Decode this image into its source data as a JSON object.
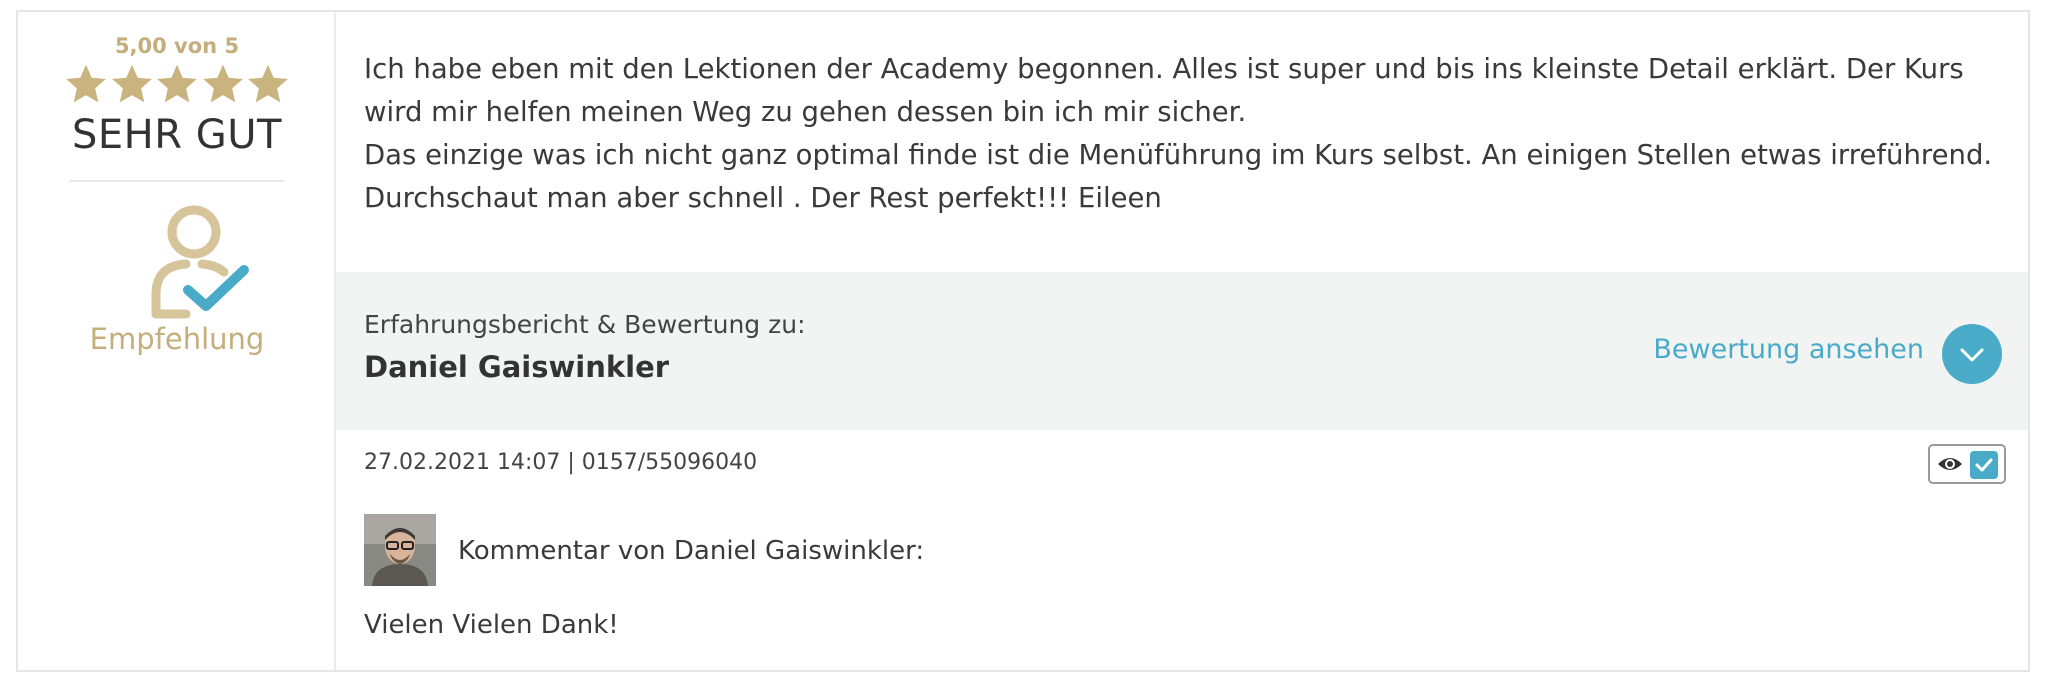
{
  "rating": {
    "score_text": "5,00 von 5",
    "stars": 5,
    "label": "SEHR GUT",
    "recommendation_label": "Empfehlung",
    "star_color": "#c9b47f",
    "accent_color": "#c4ae7c"
  },
  "review": {
    "lines": [
      "Ich habe eben mit den Lektionen der Academy begonnen. Alles ist super und bis ins kleinste Detail erklärt. Der Kurs wird mir helfen meinen Weg zu gehen dessen bin ich mir sicher.",
      "Das einzige was ich nicht ganz optimal finde ist die Menüführung im Kurs selbst. An einigen Stellen etwas irreführend. Durchschaut man aber schnell . Der Rest perfekt!!! Eileen"
    ]
  },
  "subject": {
    "label": "Erfahrungsbericht & Bewertung zu:",
    "name": "Daniel Gaiswinkler",
    "view_link": "Bewertung ansehen",
    "link_color": "#4aabc9"
  },
  "meta": {
    "datetime_phone": "27.02.2021 14:07 | 0157/55096040"
  },
  "moderation": {
    "icons": [
      "eye-icon",
      "checkmark-icon"
    ]
  },
  "comment": {
    "header": "Kommentar von Daniel Gaiswinkler:",
    "body": "Vielen Vielen Dank!"
  }
}
